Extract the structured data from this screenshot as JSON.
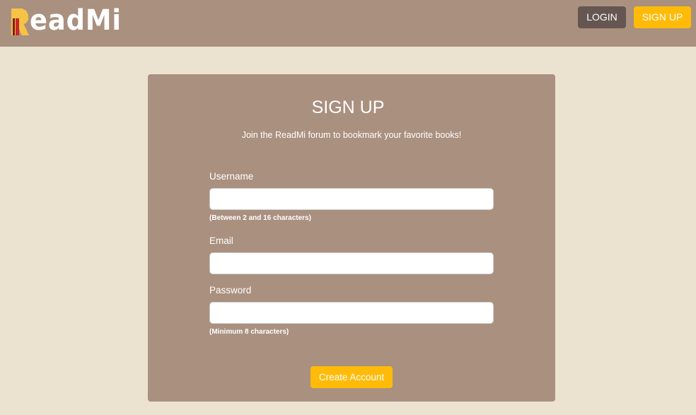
{
  "header": {
    "logo": {
      "initial": "R",
      "text": "eadMi",
      "full_name": "ReadMi"
    },
    "login_label": "LOGIN",
    "signup_label": "SIGN UP"
  },
  "form": {
    "title": "SIGN UP",
    "subtitle": "Join the ReadMi forum to bookmark your favorite books!",
    "fields": [
      {
        "label": "Username",
        "value": "",
        "hint": "(Between 2 and 16 characters)"
      },
      {
        "label": "Email",
        "value": ""
      },
      {
        "label": "Password",
        "value": "",
        "hint": "(Minimum 8 characters)"
      }
    ],
    "submit_label": "Create Account"
  },
  "colors": {
    "page_background": "#ebe3cf",
    "header_background": "#aa907f",
    "card_background": "#aa907f",
    "login_button": "#655652",
    "accent": "#ffbb08",
    "logo_yellow": "#f5c346",
    "logo_red": "#c8242b"
  }
}
